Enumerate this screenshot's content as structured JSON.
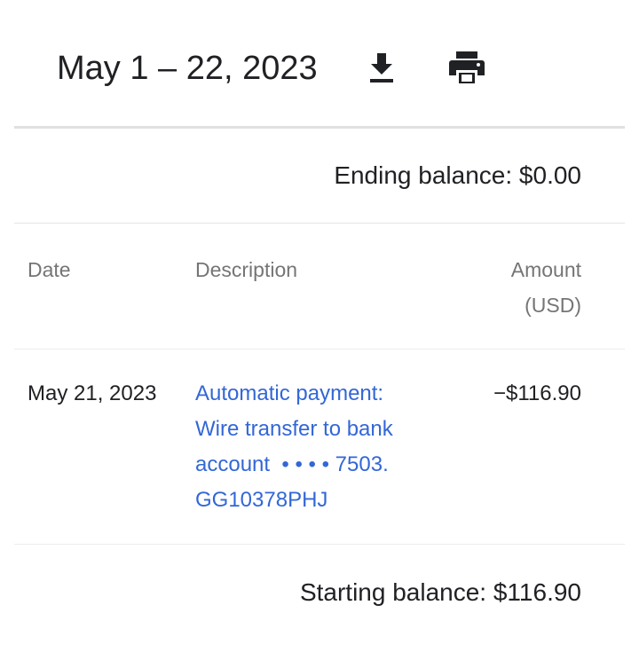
{
  "header": {
    "title": "May 1 – 22, 2023",
    "download_icon": "download-icon",
    "print_icon": "print-icon"
  },
  "ending_balance": "Ending balance: $0.00",
  "table": {
    "columns": {
      "date": "Date",
      "description": "Description",
      "amount_line1": "Amount",
      "amount_line2": "(USD)"
    },
    "rows": [
      {
        "date": "May 21, 2023",
        "description_lines": [
          "Automatic payment:",
          "Wire transfer to bank",
          "account  • • • • 7503.",
          "GG10378PHJ"
        ],
        "amount": "−$116.90"
      }
    ]
  },
  "starting_balance": "Starting balance: $116.90",
  "colors": {
    "link": "#3367d6",
    "text": "#202124",
    "muted": "#757575",
    "divider": "#e0e0e0"
  }
}
